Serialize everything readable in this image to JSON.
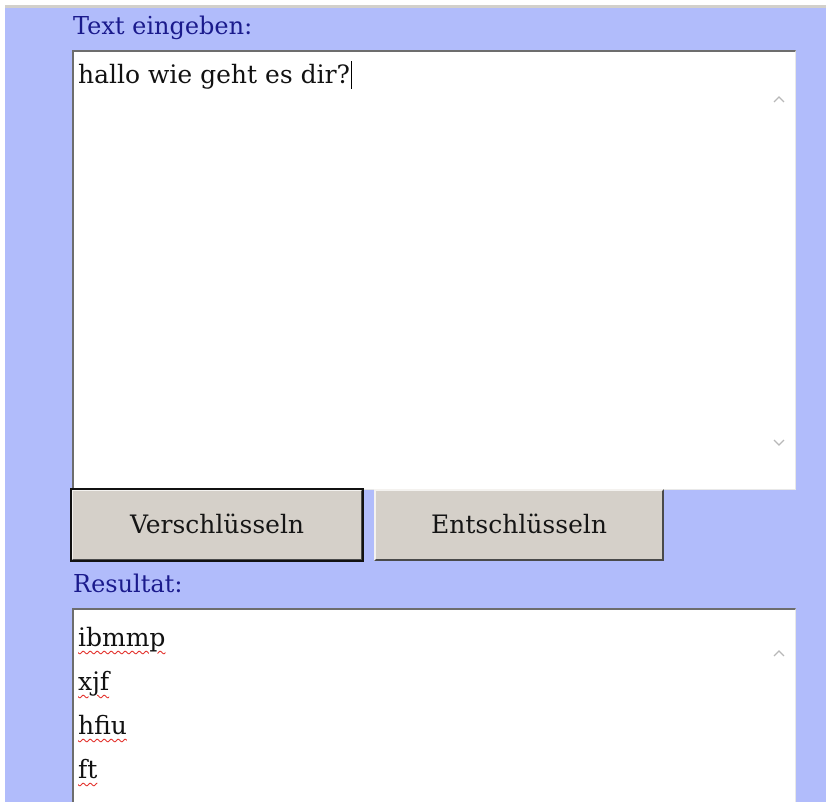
{
  "form": {
    "input_label": "Text eingeben:",
    "input_value": "hallo wie geht es dir?",
    "encrypt_button": "Verschlüsseln",
    "decrypt_button": "Entschlüsseln",
    "result_label": "Resultat:",
    "result_lines": [
      "ibmmp",
      "xjf",
      "hfiu",
      "ft"
    ]
  },
  "colors": {
    "panel_background": "#b1bcfb",
    "label_text": "#1a1a8c",
    "button_face": "#d5d0c9",
    "spellcheck_underline": "#e0201a"
  },
  "icons": {
    "scroll_up": "chevron-up-icon",
    "scroll_down": "chevron-down-icon"
  }
}
